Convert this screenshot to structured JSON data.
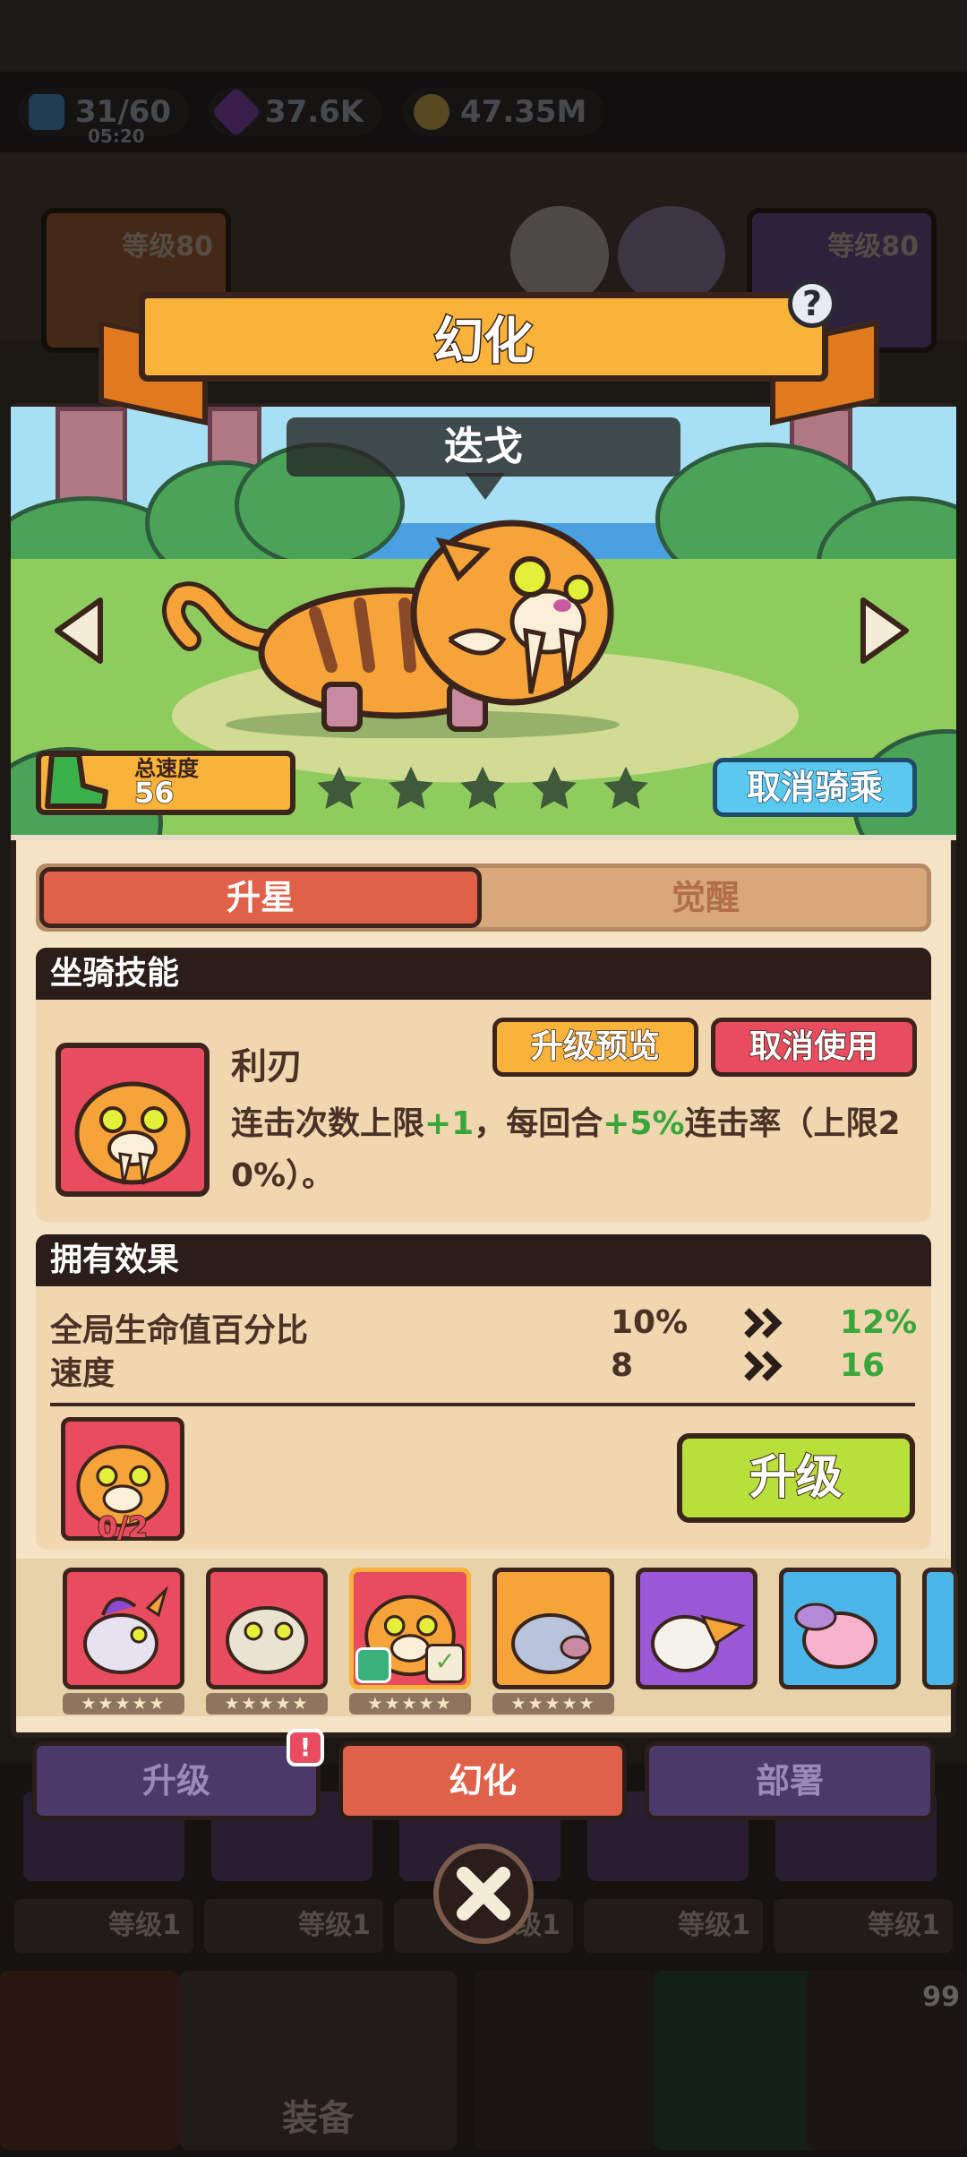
{
  "resources": {
    "energy": "31/60",
    "energy_timer": "05:20",
    "gems": "37.6K",
    "coins": "47.35M"
  },
  "background": {
    "left_slot_level": "等级80",
    "right_slot_level": "等级80",
    "grid_levels": [
      "等级1",
      "等级1",
      "等级1",
      "等级1",
      "等级1"
    ],
    "nav_label": "装备",
    "nav_badge_count": "99"
  },
  "dialog": {
    "title": "幻化",
    "help_label": "?",
    "mount_name": "迭戈",
    "speed_label": "总速度",
    "speed_value": "56",
    "star_count": 5,
    "unride_label": "取消骑乘",
    "tabs": {
      "active": "升星",
      "inactive": "觉醒"
    },
    "skill": {
      "header": "坐骑技能",
      "name": "利刃",
      "preview_label": "升级预览",
      "cancel_use_label": "取消使用",
      "desc_prefix": "连击次数上限",
      "desc_bonus1": "+1",
      "desc_mid": "，每回合",
      "desc_bonus2": "+5%",
      "desc_suffix": "连击率（上限20%）。"
    },
    "effects": {
      "header": "拥有效果",
      "rows": [
        {
          "name": "全局生命值百分比",
          "current": "10%",
          "next": "12%"
        },
        {
          "name": "速度",
          "current": "8",
          "next": "16"
        }
      ]
    },
    "shard_count": "0/2",
    "upgrade_label": "升级",
    "mount_stars": "★★★★★",
    "mounts": [
      {
        "color": "#e94c5e",
        "selected": false
      },
      {
        "color": "#e94c5e",
        "selected": false
      },
      {
        "color": "#e94c5e",
        "selected": true
      },
      {
        "color": "#f6a33a",
        "selected": false
      },
      {
        "color": "#9a58d6",
        "selected": false
      },
      {
        "color": "#4ab6e8",
        "selected": false
      }
    ]
  },
  "bottom_tabs": {
    "upgrade": "升级",
    "transform": "幻化",
    "deploy": "部署",
    "badge": "!"
  },
  "close_label": "✕"
}
